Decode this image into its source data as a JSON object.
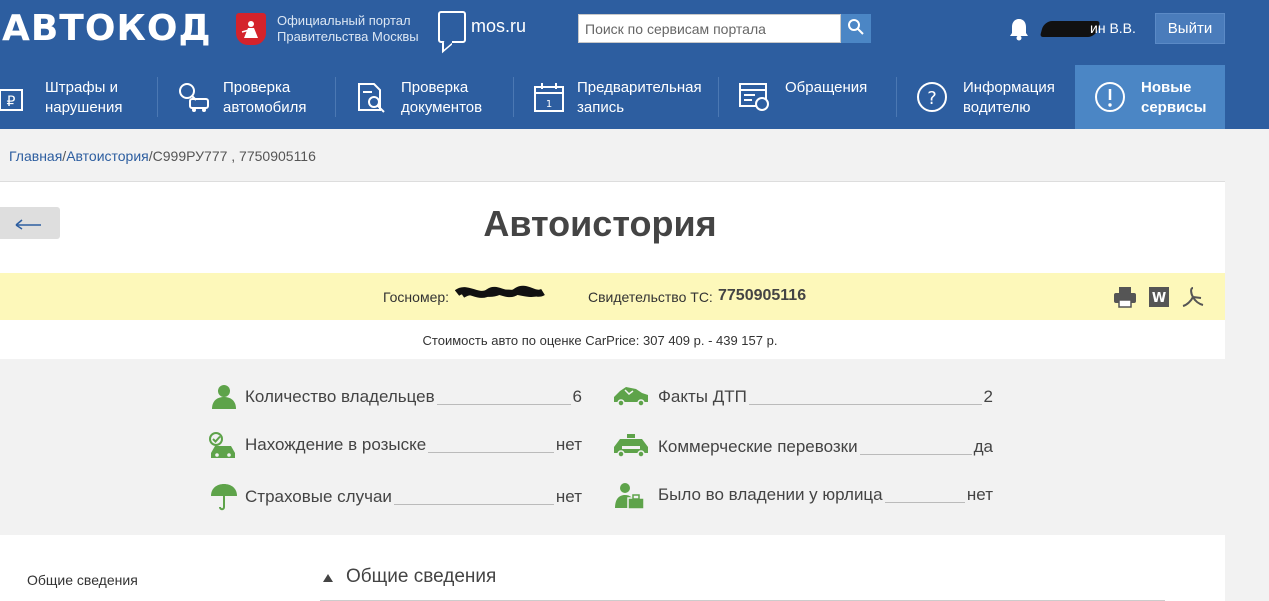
{
  "header": {
    "logo": "АВТОКОД",
    "portal_line1": "Официальный портал",
    "portal_line2": "Правительства Москвы",
    "mos_link": "mos.ru",
    "search_placeholder": "Поиск по сервисам портала",
    "user_name": "ин В.В.",
    "logout_label": "Выйти"
  },
  "nav": [
    {
      "line1": "Штрафы и",
      "line2": "нарушения",
      "icon": "ruble-document-icon"
    },
    {
      "line1": "Проверка",
      "line2": "автомобиля",
      "icon": "car-search-icon"
    },
    {
      "line1": "Проверка",
      "line2": "документов",
      "icon": "document-search-icon"
    },
    {
      "line1": "Предварительная",
      "line2": "запись",
      "icon": "calendar-icon"
    },
    {
      "line1": "Обращения",
      "line2": "",
      "icon": "appeal-icon"
    },
    {
      "line1": "Информация",
      "line2": "водителю",
      "icon": "question-icon"
    },
    {
      "line1": "Новые",
      "line2": "сервисы",
      "icon": "exclamation-icon"
    }
  ],
  "breadcrumb": {
    "home": "Главная",
    "sep1": "/",
    "history": "Автоистория",
    "sep2": "/",
    "current": "С999РУ777 , 7750905116"
  },
  "page": {
    "title": "Автоистория",
    "gos_label": "Госномер:",
    "svid_label": "Свидетельство ТС:",
    "svid_value": "7750905116",
    "price": "Стоимость авто по оценке CarPrice: 307 409 р. - 439 157 р."
  },
  "stats": [
    {
      "label": "Количество владельцев",
      "value": "6",
      "icon": "person-icon"
    },
    {
      "label": "Факты ДТП",
      "value": "2",
      "icon": "crashed-car-icon"
    },
    {
      "label": "Нахождение в розыске",
      "value": "нет",
      "icon": "car-checked-icon"
    },
    {
      "label": "Коммерческие перевозки",
      "value": "да",
      "icon": "taxi-icon"
    },
    {
      "label": "Страховые случаи",
      "value": "нет",
      "icon": "umbrella-icon"
    },
    {
      "label": "Было во владении у юрлица",
      "value": "нет",
      "icon": "businessman-icon"
    }
  ],
  "sidebar": {
    "link1": "Общие сведения"
  },
  "section": {
    "title": "Общие сведения"
  },
  "colors": {
    "header_bg": "#2d5ea0",
    "active_tab": "#4b86c5",
    "info_bar": "#fdf8ba",
    "icon_green": "#5ea34a"
  }
}
